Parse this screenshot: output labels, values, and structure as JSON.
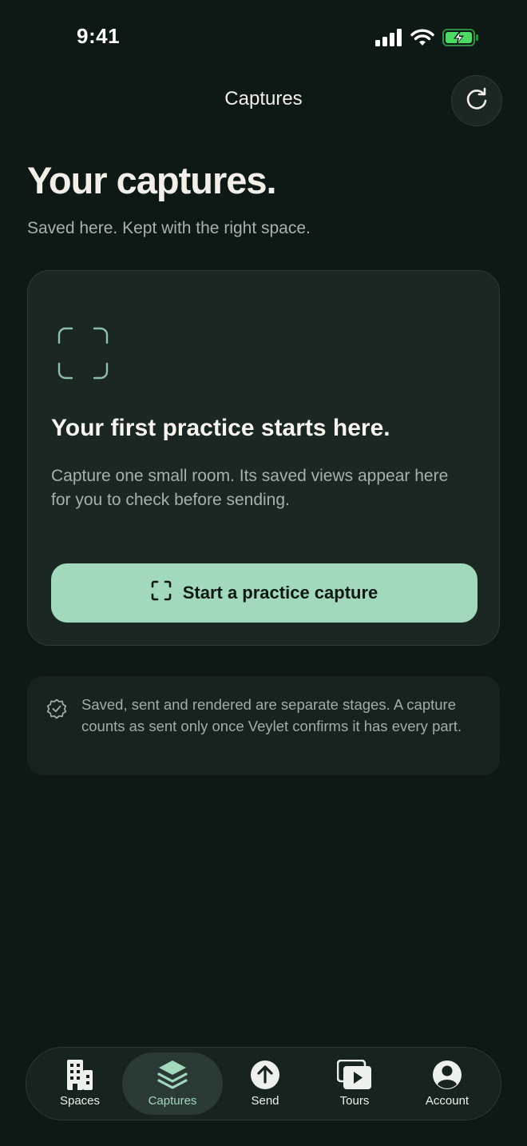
{
  "status_bar": {
    "time": "9:41"
  },
  "header": {
    "title": "Captures",
    "refresh_icon": "refresh-icon"
  },
  "page": {
    "title": "Your captures.",
    "subtitle": "Saved here. Kept with the right space."
  },
  "empty_card": {
    "icon": "capture-frame-icon",
    "title": "Your first practice starts here.",
    "body": "Capture one small room. Its saved views appear here for you to check before sending.",
    "cta_label": "Start a practice capture"
  },
  "note": {
    "icon": "verified-badge-icon",
    "text": "Saved, sent and rendered are separate stages. A capture counts as sent only once Veylet confirms it has every part."
  },
  "tabs": [
    {
      "label": "Spaces",
      "icon": "building-icon",
      "active": false
    },
    {
      "label": "Captures",
      "icon": "layers-icon",
      "active": true
    },
    {
      "label": "Send",
      "icon": "upload-arrow-icon",
      "active": false
    },
    {
      "label": "Tours",
      "icon": "play-gallery-icon",
      "active": false
    },
    {
      "label": "Account",
      "icon": "user-circle-icon",
      "active": false
    }
  ],
  "colors": {
    "background": "#0e1916",
    "card": "#1a2723",
    "accent": "#a2d9bd",
    "battery_green": "#4cd964"
  }
}
